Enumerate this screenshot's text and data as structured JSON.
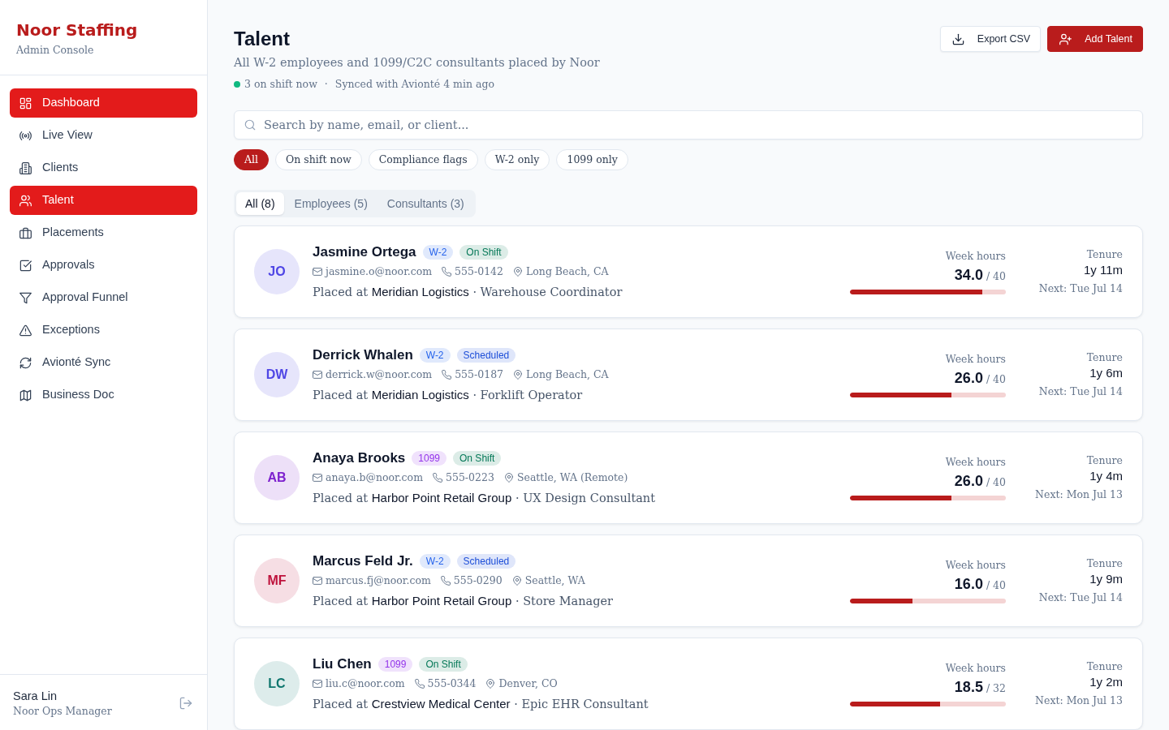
{
  "brand": {
    "title": "Noor Staffing",
    "subtitle": "Admin Console"
  },
  "sidebar": {
    "items": [
      {
        "label": "Dashboard",
        "selected": true
      },
      {
        "label": "Live View",
        "selected": false
      },
      {
        "label": "Clients",
        "selected": false
      },
      {
        "label": "Talent",
        "selected": true
      },
      {
        "label": "Placements",
        "selected": false
      },
      {
        "label": "Approvals",
        "selected": false
      },
      {
        "label": "Approval Funnel",
        "selected": false
      },
      {
        "label": "Exceptions",
        "selected": false
      },
      {
        "label": "Avionté Sync",
        "selected": false
      },
      {
        "label": "Business Doc",
        "selected": false
      }
    ],
    "user": {
      "name": "Sara Lin",
      "role": "Noor Ops Manager"
    }
  },
  "header": {
    "title": "Talent",
    "subtitle": "All W-2 employees and 1099/C2C consultants placed by Noor",
    "status": {
      "on_shift": "3 on shift now",
      "separator": "·",
      "sync": "Synced with Avionté 4 min ago"
    },
    "actions": [
      {
        "label": "Export CSV",
        "kind": "secondary"
      },
      {
        "label": "Add Talent",
        "kind": "primary"
      }
    ]
  },
  "search": {
    "placeholder": "Search by name, email, or client..."
  },
  "filters": [
    {
      "label": "All",
      "selected": true
    },
    {
      "label": "On shift now",
      "selected": false
    },
    {
      "label": "Compliance flags",
      "selected": false
    },
    {
      "label": "W-2 only",
      "selected": false
    },
    {
      "label": "1099 only",
      "selected": false
    }
  ],
  "tabs": [
    {
      "label": "All (8)",
      "selected": true
    },
    {
      "label": "Employees (5)",
      "selected": false
    },
    {
      "label": "Consultants (3)",
      "selected": false
    }
  ],
  "talent": [
    {
      "initials": "JO",
      "color": "#4f46e5",
      "name": "Jasmine Ortega",
      "type_badge": {
        "text": "W-2",
        "color": "#2563eb"
      },
      "status_badge": {
        "text": "On Shift",
        "color": "#047857"
      },
      "email": "jasmine.o@noor.com",
      "phone": "555-0142",
      "location": "Long Beach, CA",
      "placement": "Placed at **Meridian Logistics** · Warehouse Coordinator",
      "hours_label": "Week hours",
      "hours": "34.0",
      "hours_max": "/ 40",
      "level": 0.85,
      "tenure_label": "Tenure",
      "tenure": "1y 11m",
      "next": "Next: Tue Jul 14"
    },
    {
      "initials": "DW",
      "color": "#4f46e5",
      "name": "Derrick Whalen",
      "type_badge": {
        "text": "W-2",
        "color": "#2563eb"
      },
      "status_badge": {
        "text": "Scheduled",
        "color": "#1d4ed8"
      },
      "email": "derrick.w@noor.com",
      "phone": "555-0187",
      "location": "Long Beach, CA",
      "placement": "Placed at **Meridian Logistics** · Forklift Operator",
      "hours_label": "Week hours",
      "hours": "26.0",
      "hours_max": "/ 40",
      "level": 0.65,
      "tenure_label": "Tenure",
      "tenure": "1y 6m",
      "next": "Next: Tue Jul 14"
    },
    {
      "initials": "AB",
      "color": "#7e22ce",
      "name": "Anaya Brooks",
      "type_badge": {
        "text": "1099",
        "color": "#9333ea"
      },
      "status_badge": {
        "text": "On Shift",
        "color": "#047857"
      },
      "email": "anaya.b@noor.com",
      "phone": "555-0223",
      "location": "Seattle, WA (Remote)",
      "placement": "Placed at **Harbor Point Retail Group** · UX Design Consultant",
      "hours_label": "Week hours",
      "hours": "26.0",
      "hours_max": "/ 40",
      "level": 0.65,
      "tenure_label": "Tenure",
      "tenure": "1y 4m",
      "next": "Next: Mon Jul 13"
    },
    {
      "initials": "MF",
      "color": "#be123c",
      "name": "Marcus Feld Jr.",
      "type_badge": {
        "text": "W-2",
        "color": "#2563eb"
      },
      "status_badge": {
        "text": "Scheduled",
        "color": "#1d4ed8"
      },
      "email": "marcus.fj@noor.com",
      "phone": "555-0290",
      "location": "Seattle, WA",
      "placement": "Placed at **Harbor Point Retail Group** · Store Manager",
      "hours_label": "Week hours",
      "hours": "16.0",
      "hours_max": "/ 40",
      "level": 0.4,
      "tenure_label": "Tenure",
      "tenure": "1y 9m",
      "next": "Next: Tue Jul 14"
    },
    {
      "initials": "LC",
      "color": "#0f766e",
      "name": "Liu Chen",
      "type_badge": {
        "text": "1099",
        "color": "#9333ea"
      },
      "status_badge": {
        "text": "On Shift",
        "color": "#047857"
      },
      "email": "liu.c@noor.com",
      "phone": "555-0344",
      "location": "Denver, CO",
      "placement": "Placed at **Crestview Medical Center** · Epic EHR Consultant",
      "hours_label": "Week hours",
      "hours": "18.5",
      "hours_max": "/ 32",
      "level": 0.578,
      "tenure_label": "Tenure",
      "tenure": "1y 2m",
      "next": "Next: Mon Jul 13"
    }
  ]
}
